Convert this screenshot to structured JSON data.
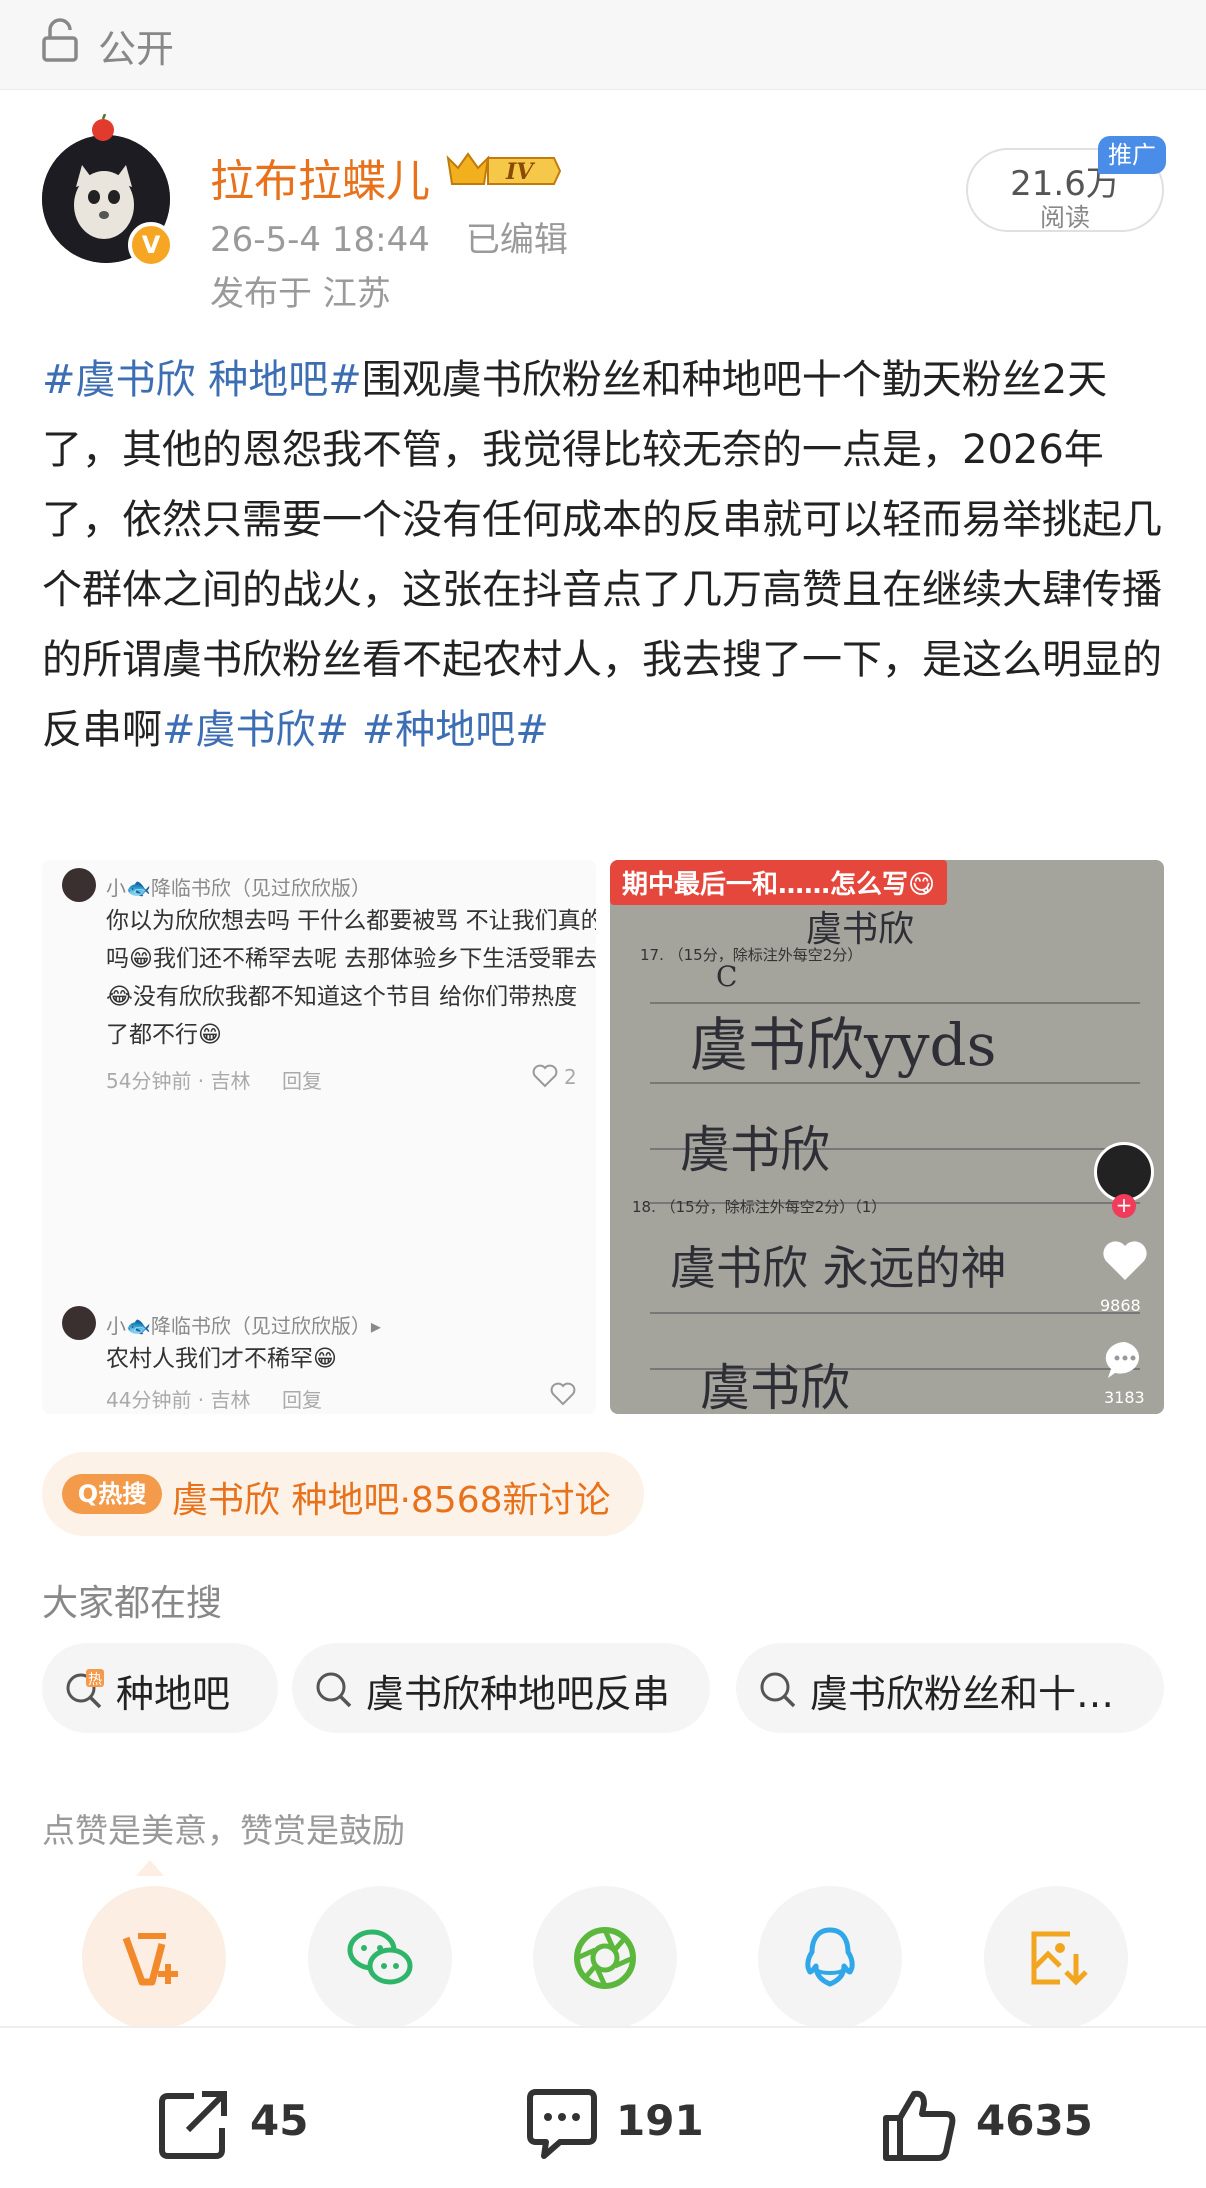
{
  "header": {
    "visibility": "公开",
    "icon": "lock-icon"
  },
  "author": {
    "name": "拉布拉蝶儿",
    "level": "IV",
    "date": "26-5-4 18:44",
    "edited": "已编辑",
    "location": "发布于 江苏",
    "verified_icon": "v-badge-icon"
  },
  "reads": {
    "count": "21.6万",
    "label": "阅读",
    "promo": "推广"
  },
  "post": {
    "tag1": "#虞书欣 种地吧#",
    "body": "围观虞书欣粉丝和种地吧十个勤天粉丝2天了，其他的恩怨我不管，我觉得比较无奈的一点是，2026年了，依然只需要一个没有任何成本的反串就可以轻而易举挑起几个群体之间的战火，这张在抖音点了几万高赞且在继续大肆传播的所谓虞书欣粉丝看不起农村人，我去搜了一下，是这么明显的反串啊",
    "tag2": "#虞书欣#",
    "tag3": "#种地吧#"
  },
  "image1": {
    "c1_name": "小🐟降临书欣（见过欣欣版）",
    "c1_line1": "你以为欣欣想去吗 干什么都要被骂 不让我们真的",
    "c1_line2": "吗😁我们还不稀罕去呢 去那体验乡下生活受罪去",
    "c1_line3": "😂没有欣欣我都不知道这个节目 给你们带热度",
    "c1_line4": "了都不行😁",
    "c1_meta": "54分钟前 · 吉林",
    "c1_reply": "回复",
    "c1_likes": "2",
    "c2_name": "小🐟降临书欣（见过欣欣版）▸",
    "c2_text": "农村人我们才不稀罕😁",
    "c2_meta": "44分钟前 · 吉林",
    "c2_reply": "回复"
  },
  "image2": {
    "banner": "期中最后一和……怎么写😋",
    "hw1": "虞书欣",
    "hw2": "虞书欣yyds",
    "hw3": "虞书欣",
    "hw4": "虞书欣  永远的神",
    "hw5": "虞书欣",
    "sheet_q17": "17. （15分，除标注外每空2分）",
    "sheet_q18": "18. （15分，除标注外每空2分）（1）",
    "mark_c": "C",
    "likes": "9868",
    "comments": "3183"
  },
  "hot": {
    "badge": "Q热搜",
    "text": "虞书欣 种地吧·8568新讨论"
  },
  "search": {
    "title": "大家都在搜",
    "chips": [
      "种地吧",
      "虞书欣种地吧反串",
      "虞书欣粉丝和十…"
    ],
    "hot_mark": "热"
  },
  "appreciate": "点赞是美意，赞赏是鼓励",
  "share_icons": [
    "v-plus-icon",
    "wechat-icon",
    "moments-icon",
    "qq-icon",
    "save-image-icon"
  ],
  "actions": {
    "share": "45",
    "comment": "191",
    "like": "4635"
  },
  "colors": {
    "orange": "#e8721c",
    "tag_blue": "#3d6eb4",
    "promo_blue": "#4a8de8"
  }
}
